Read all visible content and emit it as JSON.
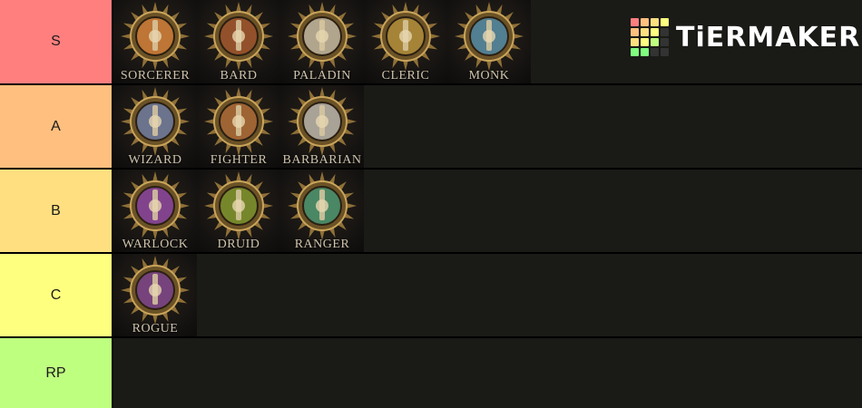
{
  "brand": {
    "logo_text": "TiERMAKER",
    "logo_grid_colors": [
      "#ff7f7f",
      "#ffbf7f",
      "#ffdf7f",
      "#ffff7f",
      "#ffbf7f",
      "#ffdf7f",
      "#ffff7f",
      "#333333",
      "#ffdf7f",
      "#ffff7f",
      "#bfff7f",
      "#333333",
      "#7fff7f",
      "#7fff7f",
      "#333333",
      "#333333"
    ]
  },
  "tiers": [
    {
      "label": "S",
      "color": "#ff7f7f",
      "items": [
        {
          "name": "SORCERER",
          "icon": "sorcerer-emblem-icon",
          "accent": "#d9823b"
        },
        {
          "name": "BARD",
          "icon": "bard-emblem-icon",
          "accent": "#a0522d"
        },
        {
          "name": "PALADIN",
          "icon": "paladin-emblem-icon",
          "accent": "#c9c2b0"
        },
        {
          "name": "CLERIC",
          "icon": "cleric-emblem-icon",
          "accent": "#b8963e"
        },
        {
          "name": "MONK",
          "icon": "monk-emblem-icon",
          "accent": "#4a8fb5"
        }
      ]
    },
    {
      "label": "A",
      "color": "#ffbf7f",
      "items": [
        {
          "name": "WIZARD",
          "icon": "wizard-emblem-icon",
          "accent": "#6b7fb0"
        },
        {
          "name": "FIGHTER",
          "icon": "fighter-emblem-icon",
          "accent": "#b06b3a"
        },
        {
          "name": "BARBARIAN",
          "icon": "barbarian-emblem-icon",
          "accent": "#bdbdbd"
        }
      ]
    },
    {
      "label": "B",
      "color": "#ffdf7f",
      "items": [
        {
          "name": "WARLOCK",
          "icon": "warlock-emblem-icon",
          "accent": "#8a3fb0"
        },
        {
          "name": "DRUID",
          "icon": "druid-emblem-icon",
          "accent": "#7a9a2e"
        },
        {
          "name": "RANGER",
          "icon": "ranger-emblem-icon",
          "accent": "#3f9a7a"
        }
      ]
    },
    {
      "label": "C",
      "color": "#ffff7f",
      "items": [
        {
          "name": "ROGUE",
          "icon": "rogue-emblem-icon",
          "accent": "#7a3f9a"
        }
      ]
    },
    {
      "label": "RP",
      "color": "#bfff7f",
      "items": []
    }
  ]
}
